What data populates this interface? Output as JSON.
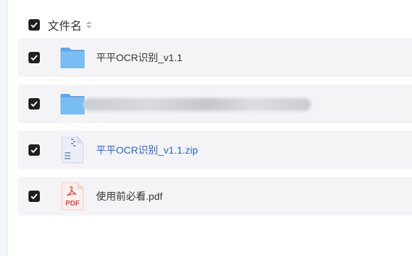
{
  "header": {
    "column_label": "文件名"
  },
  "files": [
    {
      "name": "平平OCR识别_v1.1",
      "type": "folder",
      "checked": true,
      "is_link": false,
      "blurred": false
    },
    {
      "name": "",
      "type": "folder",
      "checked": true,
      "is_link": false,
      "blurred": true
    },
    {
      "name": "平平OCR识别_v1.1.zip",
      "type": "zip",
      "checked": true,
      "is_link": true,
      "blurred": false
    },
    {
      "name": "使用前必看.pdf",
      "type": "pdf",
      "checked": true,
      "is_link": false,
      "blurred": false
    }
  ],
  "colors": {
    "checkbox": "#1f1f24",
    "link": "#2c62d6",
    "row_bg": "#f4f4f6",
    "folder": "#6fb3f2",
    "pdf": "#e8453c"
  }
}
